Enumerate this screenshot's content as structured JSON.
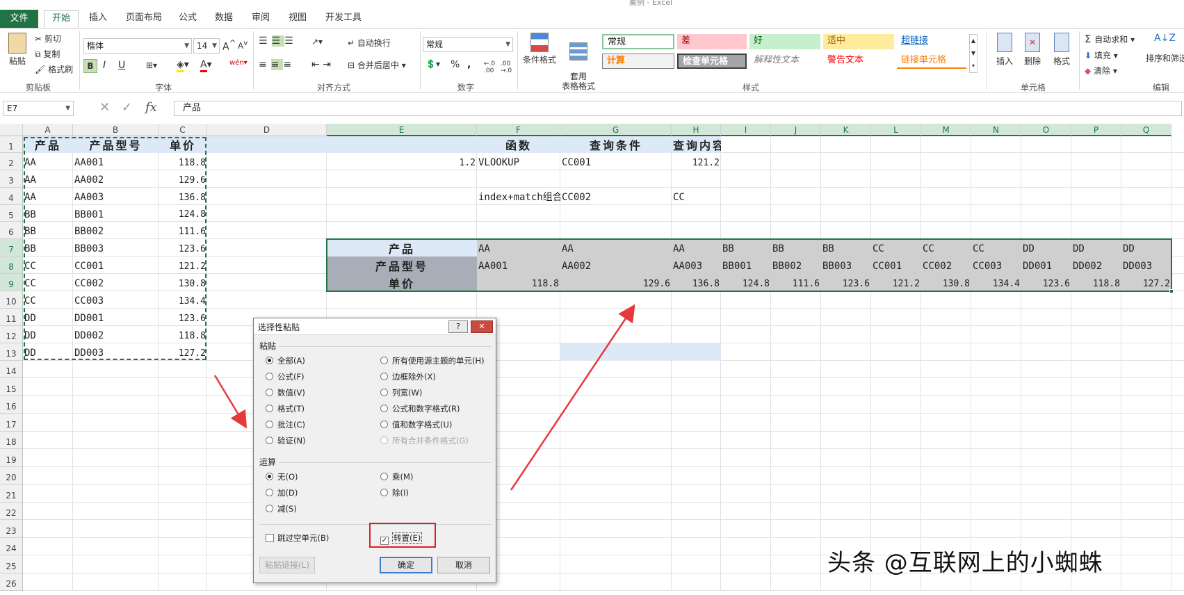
{
  "titlebar": {
    "title": "案例 - Excel"
  },
  "tabs": [
    "文件",
    "开始",
    "插入",
    "页面布局",
    "公式",
    "数据",
    "审阅",
    "视图",
    "开发工具"
  ],
  "ribbon": {
    "clipboard": {
      "paste": "粘贴",
      "cut": "剪切",
      "copy": "复制",
      "format_painter": "格式刷",
      "label": "剪贴板"
    },
    "font": {
      "name": "楷体",
      "size": "14",
      "bold": "B",
      "italic": "I",
      "underline": "U",
      "label": "字体"
    },
    "alignment": {
      "wrap": "自动换行",
      "merge": "合并后居中",
      "label": "对齐方式"
    },
    "number": {
      "format": "常规",
      "percent": "%",
      "comma": ",",
      "label": "数字"
    },
    "styles": {
      "cond_format": "条件格式",
      "table_format": "套用\n表格格式",
      "cells": [
        "常规",
        "差",
        "好",
        "适中",
        "超链接",
        "计算",
        "检查单元格",
        "解释性文本",
        "警告文本",
        "链接单元格"
      ],
      "label": "样式"
    },
    "cells_grp": {
      "insert": "插入",
      "delete": "删除",
      "format": "格式",
      "label": "单元格"
    },
    "editing": {
      "autosum": "自动求和",
      "fill": "填充",
      "clear": "清除",
      "sort": "排序和筛选",
      "label": "编辑"
    }
  },
  "formula_bar": {
    "name_box": "E7",
    "fx": "fx",
    "content": "产品"
  },
  "columns": [
    "A",
    "B",
    "C",
    "D",
    "E",
    "F",
    "G",
    "H",
    "I",
    "J",
    "K",
    "L",
    "M",
    "N",
    "O",
    "P",
    "Q"
  ],
  "rows": [
    "1",
    "2",
    "3",
    "4",
    "5",
    "6",
    "7",
    "8",
    "9",
    "10",
    "11",
    "12",
    "13",
    "14",
    "15",
    "16",
    "17",
    "18",
    "19",
    "20",
    "21",
    "22",
    "23",
    "24",
    "25",
    "26"
  ],
  "source_table": {
    "headers": [
      "产品",
      "产品型号",
      "单价"
    ],
    "rows": [
      [
        "AA",
        "AA001",
        "118.8"
      ],
      [
        "AA",
        "AA002",
        "129.6"
      ],
      [
        "AA",
        "AA003",
        "136.8"
      ],
      [
        "BB",
        "BB001",
        "124.8"
      ],
      [
        "BB",
        "BB002",
        "111.6"
      ],
      [
        "BB",
        "BB003",
        "123.6"
      ],
      [
        "CC",
        "CC001",
        "121.2"
      ],
      [
        "CC",
        "CC002",
        "130.8"
      ],
      [
        "CC",
        "CC003",
        "134.4"
      ],
      [
        "DD",
        "DD001",
        "123.6"
      ],
      [
        "DD",
        "DD002",
        "118.8"
      ],
      [
        "DD",
        "DD003",
        "127.2"
      ]
    ]
  },
  "lookup": {
    "headers": [
      "函数",
      "查询条件",
      "查询内容"
    ],
    "e2": "1.2",
    "f2": "VLOOKUP",
    "g2": "CC001",
    "h2": "121.2",
    "f4": "index+match组合",
    "g4": "CC002",
    "h4": "CC"
  },
  "transposed": {
    "labels": [
      "产品",
      "产品型号",
      "单价"
    ],
    "products": [
      "AA",
      "AA",
      "AA",
      "BB",
      "BB",
      "BB",
      "CC",
      "CC",
      "CC",
      "DD",
      "DD",
      "DD"
    ],
    "models": [
      "AA001",
      "AA002",
      "AA003",
      "BB001",
      "BB002",
      "BB003",
      "CC001",
      "CC002",
      "CC003",
      "DD001",
      "DD002",
      "DD003"
    ],
    "prices": [
      "118.8",
      "129.6",
      "136.8",
      "124.8",
      "111.6",
      "123.6",
      "121.2",
      "130.8",
      "134.4",
      "123.6",
      "118.8",
      "127.2"
    ]
  },
  "dialog": {
    "title": "选择性粘贴",
    "help": "?",
    "close": "✕",
    "paste_section": "粘贴",
    "paste_left": [
      "全部(A)",
      "公式(F)",
      "数值(V)",
      "格式(T)",
      "批注(C)",
      "验证(N)"
    ],
    "paste_right": [
      "所有使用源主题的单元(H)",
      "边框除外(X)",
      "列宽(W)",
      "公式和数字格式(R)",
      "值和数字格式(U)",
      "所有合并条件格式(G)"
    ],
    "op_section": "运算",
    "op_left": [
      "无(O)",
      "加(D)",
      "减(S)"
    ],
    "op_right": [
      "乘(M)",
      "除(I)"
    ],
    "skip_blanks": "跳过空单元(B)",
    "transpose": "转置(E)",
    "paste_link": "粘贴链接(L)",
    "ok": "确定",
    "cancel": "取消"
  },
  "watermark": "头条 @互联网上的小蜘蛛",
  "colors": {
    "excel_green": "#217346",
    "arrow_red": "#e8393a",
    "highlight_box": "#e02020"
  }
}
